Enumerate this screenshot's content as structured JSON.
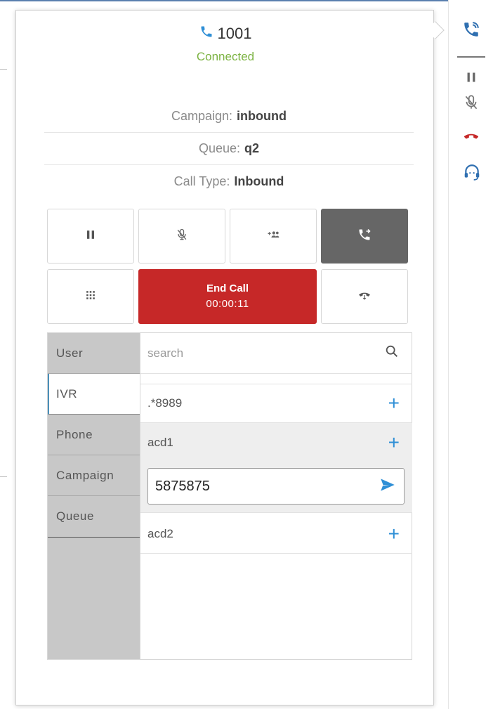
{
  "call": {
    "number": "1001",
    "status": "Connected",
    "campaign_label": "Campaign:",
    "campaign_value": "inbound",
    "queue_label": "Queue:",
    "queue_value": "q2",
    "call_type_label": "Call Type:",
    "call_type_value": "Inbound"
  },
  "controls": {
    "end_call_label": "End Call",
    "end_call_timer": "00:00:11"
  },
  "transfer": {
    "tabs": [
      {
        "label": "User"
      },
      {
        "label": "IVR"
      },
      {
        "label": "Phone"
      },
      {
        "label": "Campaign"
      },
      {
        "label": "Queue"
      }
    ],
    "active_tab": "IVR",
    "search_placeholder": "search",
    "items": [
      {
        "label": ".*8989"
      },
      {
        "label": "acd1"
      },
      {
        "label": "acd2"
      }
    ],
    "number_input_value": "5875875"
  },
  "colors": {
    "accent_blue": "#2f8fd6",
    "connected_green": "#7cb342",
    "end_call_red": "#c62828",
    "active_button": "#666666"
  },
  "icons": {
    "header": "phone-icon",
    "right_bar": [
      "phone-transfer-icon",
      "pause-icon",
      "mute-icon",
      "hangup-icon",
      "headset-icon"
    ]
  }
}
